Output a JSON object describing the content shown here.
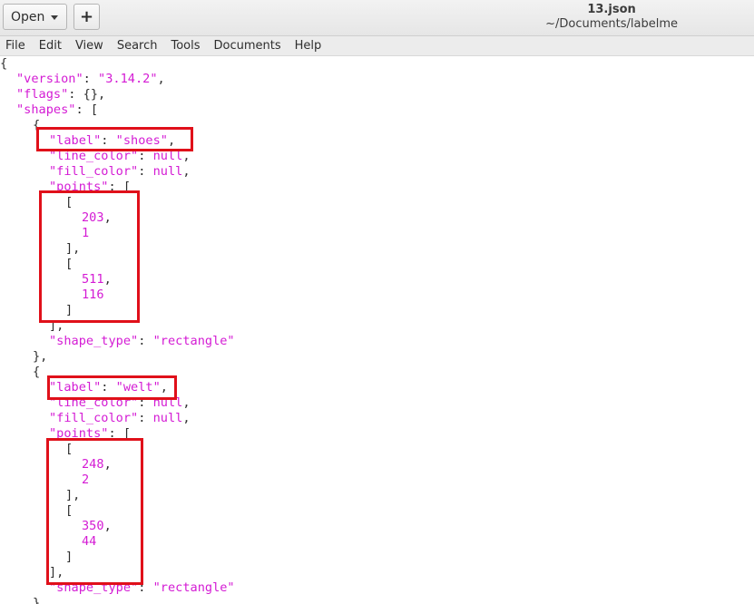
{
  "toolbar": {
    "open_label": "Open",
    "new_label": "+",
    "title": "13.json",
    "subtitle": "~/Documents/labelme"
  },
  "menu": [
    "File",
    "Edit",
    "View",
    "Search",
    "Tools",
    "Documents",
    "Help"
  ],
  "icons": {
    "open_dropdown": "chevron-down-icon",
    "new_tab": "plus-icon"
  },
  "colors": {
    "string": "#d41bd4",
    "text": "#2e2e2e",
    "highlight": "#e0101a"
  },
  "json_document": {
    "version": "3.14.2",
    "flags_literal": "{}",
    "shapes": [
      {
        "label": "shoes",
        "line_color": "null",
        "fill_color": "null",
        "points": [
          [
            "203",
            "1"
          ],
          [
            "511",
            "116"
          ]
        ],
        "shape_type": "rectangle"
      },
      {
        "label": "welt",
        "line_color": "null",
        "fill_color": "null",
        "points": [
          [
            "248",
            "2"
          ],
          [
            "350",
            "44"
          ]
        ],
        "shape_type": "rectangle"
      }
    ]
  },
  "tokens": {
    "open_brace": "{",
    "close_brace": "}",
    "open_bracket": "[",
    "close_bracket": "]",
    "bracket_comma": "],",
    "brace_comma": "},",
    "comma": ",",
    "colon": ": ",
    "key_version": "\"version\"",
    "key_flags": "\"flags\"",
    "key_shapes": "\"shapes\"",
    "key_label": "\"label\"",
    "key_line_color": "\"line_color\"",
    "key_fill_color": "\"fill_color\"",
    "key_points": "\"points\"",
    "key_shape_type": "\"shape_type\"",
    "val_version": "\"3.14.2\"",
    "val_shoes": "\"shoes\"",
    "val_welt": "\"welt\"",
    "val_rectangle": "\"rectangle\"",
    "val_null": "null"
  }
}
